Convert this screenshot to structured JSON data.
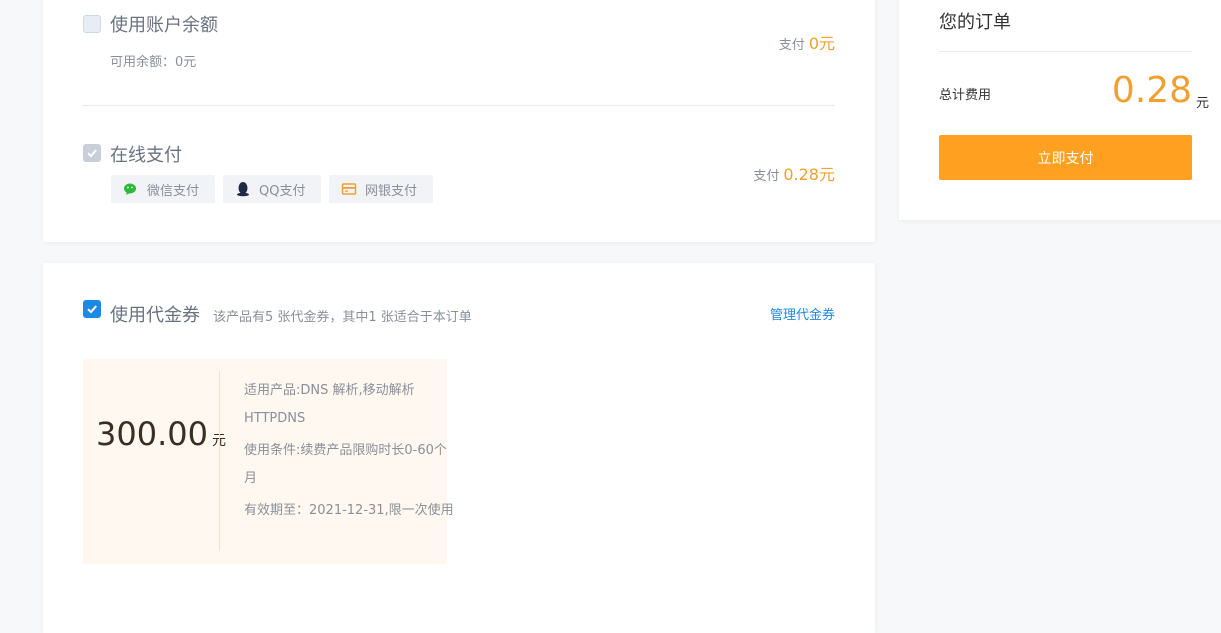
{
  "payment": {
    "balance": {
      "title": "使用账户余额",
      "available": "可用余额：0元",
      "pay_label": "支付",
      "pay_amount": "0元"
    },
    "online": {
      "title": "在线支付",
      "pay_label": "支付",
      "pay_amount": "0.28元",
      "methods": [
        {
          "label": "微信支付",
          "icon": "wechat-icon"
        },
        {
          "label": "QQ支付",
          "icon": "qq-icon"
        },
        {
          "label": "网银支付",
          "icon": "bank-card-icon"
        }
      ]
    }
  },
  "coupon": {
    "title": "使用代金券",
    "summary": "该产品有5 张代金券，其中1 张适合于本订单",
    "manage_link": "管理代金券",
    "item": {
      "value": "300.00",
      "unit": "元",
      "products": "适用产品:DNS 解析,移动解析HTTPDNS",
      "condition": "使用条件:续费产品限购时长0-60个月",
      "expiry": "有效期至：2021-12-31,限一次使用"
    }
  },
  "order": {
    "title": "您的订单",
    "total_label": "总计费用",
    "total_value": "0.28",
    "total_unit": "元",
    "pay_button": "立即支付"
  },
  "colors": {
    "accent_orange": "#ffa020",
    "link_blue": "#1e88e5",
    "amount_orange": "#f0a030"
  }
}
